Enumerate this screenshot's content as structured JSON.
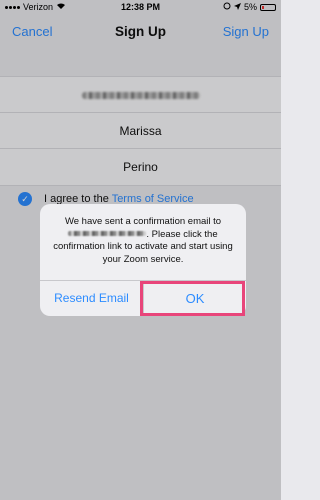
{
  "status_bar": {
    "carrier": "Verizon",
    "time": "12:38 PM",
    "battery": "5%"
  },
  "nav": {
    "cancel": "Cancel",
    "title": "Sign Up",
    "sign_up": "Sign Up"
  },
  "form": {
    "first_name": "Marissa",
    "last_name": "Perino",
    "terms_prefix": "I agree to the",
    "terms_link": "Terms of Service"
  },
  "alert": {
    "message_line1": "We have sent a confirmation email to",
    "message_after_email": ". Please click the confirmation link to activate and start using your Zoom service.",
    "resend_label": "Resend Email",
    "ok_label": "OK"
  },
  "colors": {
    "accent": "#2d8cff",
    "highlight": "#e8457a"
  }
}
